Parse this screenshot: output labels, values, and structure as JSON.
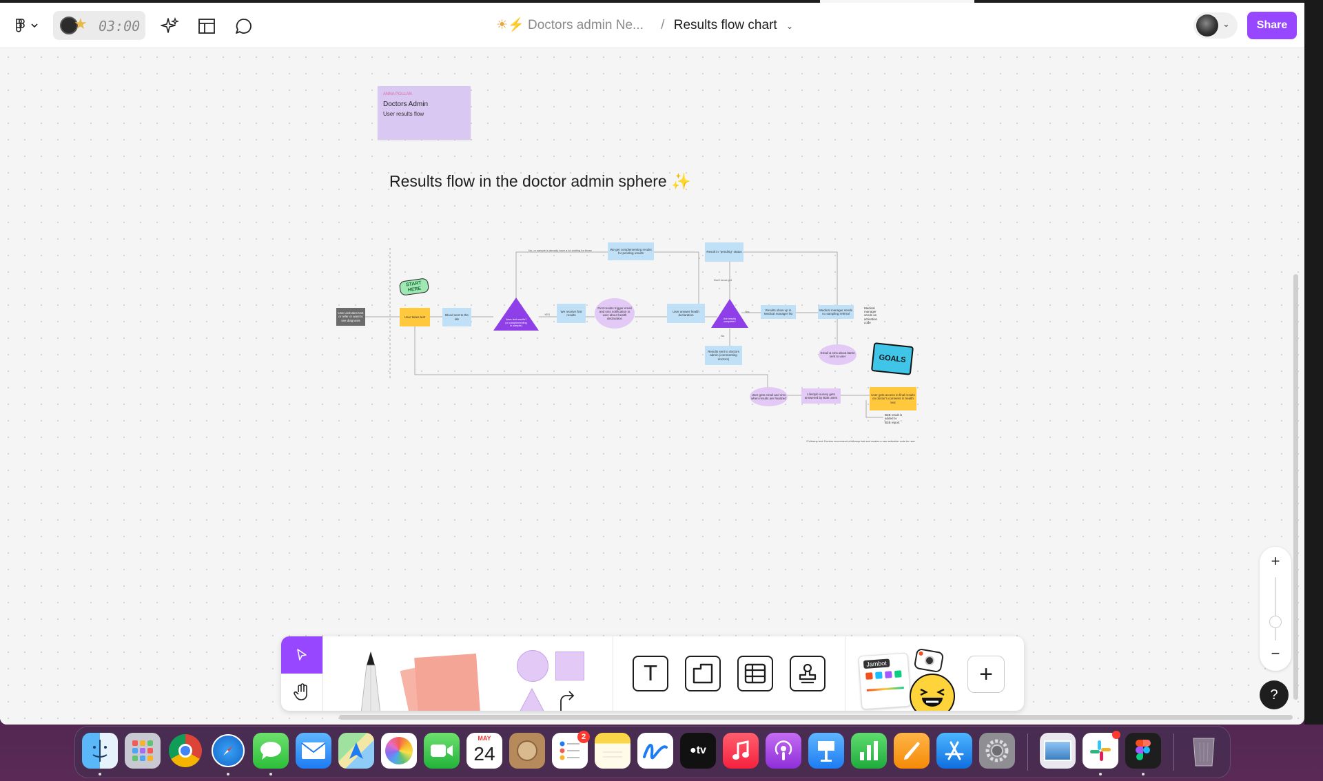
{
  "toolbar": {
    "timer": "03:00",
    "breadcrumb_project": "Doctors admin Ne...",
    "breadcrumb_separator": "/",
    "file_title": "Results flow chart",
    "share_label": "Share",
    "colors": {
      "accent": "#9747ff"
    }
  },
  "board": {
    "sticky": {
      "author": "ANNA POLLAN",
      "line1": "Doctors Admin",
      "line2": "User results flow"
    },
    "heading": "Results flow in the doctor admin sphere",
    "heading_emoji": "✨"
  },
  "flowchart": {
    "start_sticker": "START HERE",
    "goals_sticker": "GOALS",
    "nodes": {
      "n_start": "User activates test or refer or want to see diagnosis",
      "n_user_test": "User takes test",
      "n_blood": "Blood sent to the lab",
      "n_decision1": "Have test results? (or complementing in sample)",
      "n_receive": "We receive first results",
      "n_first_results": "First results trigger email and sms notification to user about health declaration",
      "n_health_decl": "User answer health declaration",
      "n_decision2": "Are results complete?",
      "n_complementing": "We get complementing results for pending results",
      "n_pending": "Result in \"pending\" status",
      "n_med_list": "Results show up in Medical manager list",
      "n_referral": "Medical manager sends no sampling referral",
      "n_med_note": "Medical manager sends an activation code",
      "n_doctor_sent": "Results sent to doctors admin (commenting doctors)",
      "n_email_sms": "Email & sms about latest sent to user",
      "n_user_email": "User gets email and sms when results are finalized",
      "n_lifestyle": "Lifestyle survey gets answered by B2B users",
      "n_access": "User gets access to final results on doctor's comment in health test",
      "n_b2b": "B2B result is added to B2B report"
    },
    "labels": {
      "l_no": "No, or sample is already have a lot waiting for those",
      "l_yes": "YES",
      "l_dont_know": "Don't know yet",
      "l_yes2": "Yes",
      "l_no2": "No",
      "l_footnote": "*Followup test: Doctors recommend a followup test and creates a new activation code for user"
    }
  },
  "zoom": {
    "plus": "+",
    "minus": "−"
  },
  "help_label": "?",
  "bottom_toolbar": {
    "stickers_label": "Jambot"
  },
  "macdock": {
    "calendar_month": "MAY",
    "calendar_day": "24",
    "reminders_badge": "2",
    "appletv_label": "tv"
  }
}
